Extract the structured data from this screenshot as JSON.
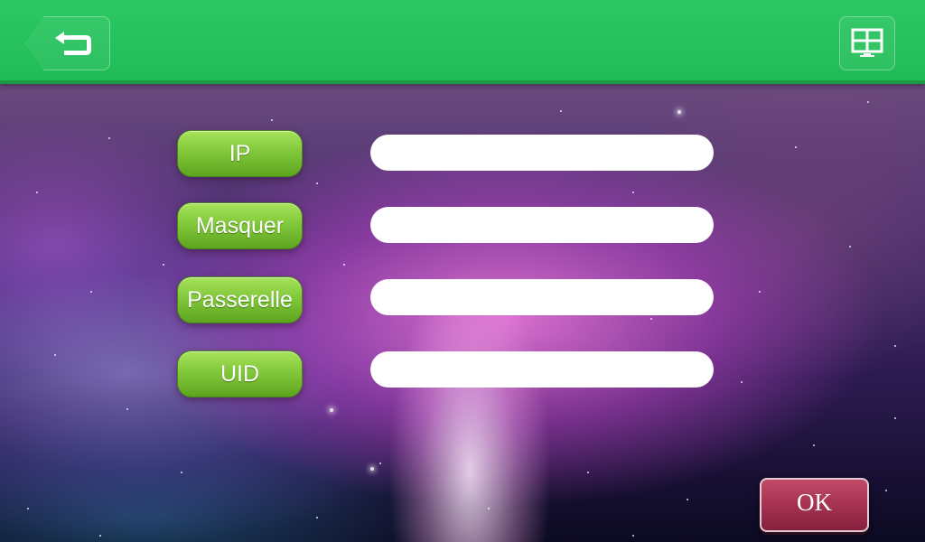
{
  "header": {
    "back_icon": "back-arrow-icon",
    "grid_icon": "grid-monitor-icon",
    "accent_color": "#21bc57"
  },
  "form": {
    "rows": [
      {
        "label": "IP",
        "value": ""
      },
      {
        "label": "Masquer",
        "value": ""
      },
      {
        "label": "Passerelle",
        "value": ""
      },
      {
        "label": "UID",
        "value": ""
      }
    ]
  },
  "footer": {
    "ok_label": "OK",
    "ok_color": "#a3304f"
  }
}
